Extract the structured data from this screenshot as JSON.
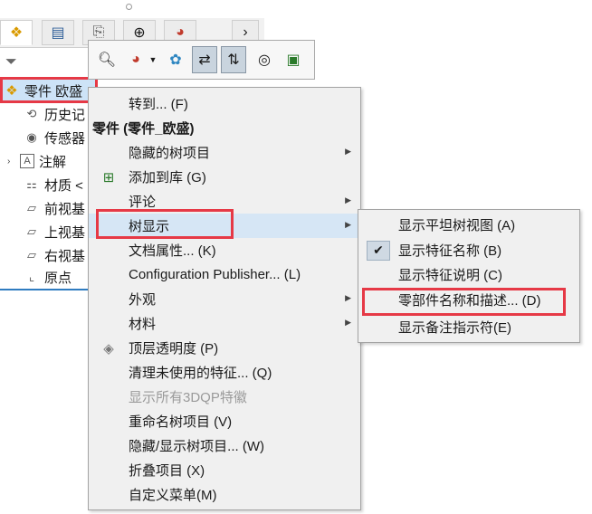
{
  "tree": {
    "root": "零件 欧盛",
    "items": [
      {
        "label": "历史记",
        "icon": "history-icon"
      },
      {
        "label": "传感器",
        "icon": "sensor-icon"
      },
      {
        "label": "注解",
        "icon": "annotation-icon"
      },
      {
        "label": "材质 <",
        "icon": "material-icon"
      },
      {
        "label": "前视基",
        "icon": "plane-icon"
      },
      {
        "label": "上视基",
        "icon": "plane-icon"
      },
      {
        "label": "右视基",
        "icon": "plane-icon"
      },
      {
        "label": "原点",
        "icon": "origin-icon"
      }
    ]
  },
  "menu": {
    "goto": "转到... (F)",
    "header": "零件 (零件_欧盛)",
    "items": [
      {
        "label": "隐藏的树项目",
        "sub": true
      },
      {
        "label": "添加到库 (G)"
      },
      {
        "label": "评论",
        "sub": true
      },
      {
        "label": "树显示",
        "sub": true
      },
      {
        "label": "文档属性... (K)"
      },
      {
        "label": "Configuration Publisher... (L)"
      },
      {
        "label": "外观",
        "sub": true
      },
      {
        "label": "材料",
        "sub": true
      },
      {
        "label": "顶层透明度 (P)"
      },
      {
        "label": "清理未使用的特征... (Q)"
      },
      {
        "label": "显示所有3DQP特徽",
        "disabled": true
      },
      {
        "label": "重命名树项目 (V)"
      },
      {
        "label": "隐藏/显示树项目... (W)"
      },
      {
        "label": "折叠项目 (X)"
      },
      {
        "label": "自定义菜单(M)"
      }
    ]
  },
  "submenu": {
    "items": [
      {
        "label": "显示平坦树视图 (A)"
      },
      {
        "label": "显示特征名称 (B)",
        "checked": true
      },
      {
        "label": "显示特征说明 (C)"
      },
      {
        "label": "零部件名称和描述... (D)"
      },
      {
        "label": "显示备注指示符(E)"
      }
    ]
  },
  "colors": {
    "highlight_box": "#e63946",
    "menu_bg": "#f0f0f0"
  }
}
